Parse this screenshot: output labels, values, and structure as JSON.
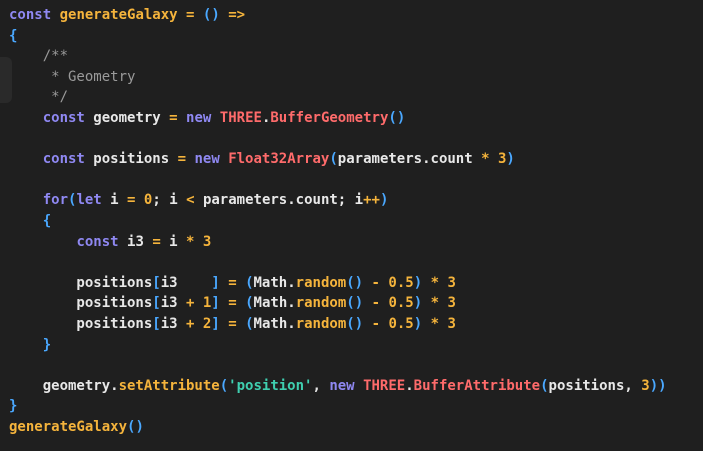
{
  "colors": {
    "background": "#1f1f1f",
    "keyword": "#8f88f2",
    "function": "#f5b43c",
    "class": "#ff6b6b",
    "bracket": "#4aa8ff",
    "string": "#3fcfb0",
    "comment": "#9a9a9a",
    "text": "#e8e8e8"
  },
  "lines": [
    [
      [
        "kw",
        "const"
      ],
      [
        "pl",
        " "
      ],
      [
        "fn",
        "generateGalaxy"
      ],
      [
        "pl",
        " "
      ],
      [
        "op",
        "="
      ],
      [
        "pl",
        " "
      ],
      [
        "br",
        "()"
      ],
      [
        "pl",
        " "
      ],
      [
        "op",
        "=>"
      ]
    ],
    [
      [
        "br",
        "{"
      ]
    ],
    [
      [
        "cm",
        "    /**"
      ]
    ],
    [
      [
        "cm",
        "     * Geometry"
      ]
    ],
    [
      [
        "cm",
        "     */"
      ]
    ],
    [
      [
        "pl",
        "    "
      ],
      [
        "kw",
        "const"
      ],
      [
        "pl",
        " geometry "
      ],
      [
        "op",
        "="
      ],
      [
        "pl",
        " "
      ],
      [
        "kw",
        "new"
      ],
      [
        "pl",
        " "
      ],
      [
        "cls",
        "THREE"
      ],
      [
        "pl",
        "."
      ],
      [
        "cls",
        "BufferGeometry"
      ],
      [
        "br",
        "()"
      ]
    ],
    [],
    [
      [
        "pl",
        "    "
      ],
      [
        "kw",
        "const"
      ],
      [
        "pl",
        " positions "
      ],
      [
        "op",
        "="
      ],
      [
        "pl",
        " "
      ],
      [
        "kw",
        "new"
      ],
      [
        "pl",
        " "
      ],
      [
        "cls",
        "Float32Array"
      ],
      [
        "br",
        "("
      ],
      [
        "pl",
        "parameters.count "
      ],
      [
        "op",
        "*"
      ],
      [
        "pl",
        " "
      ],
      [
        "num",
        "3"
      ],
      [
        "br",
        ")"
      ]
    ],
    [],
    [
      [
        "pl",
        "    "
      ],
      [
        "kw",
        "for"
      ],
      [
        "br",
        "("
      ],
      [
        "kw",
        "let"
      ],
      [
        "pl",
        " i "
      ],
      [
        "op",
        "="
      ],
      [
        "pl",
        " "
      ],
      [
        "num",
        "0"
      ],
      [
        "pl",
        "; i "
      ],
      [
        "op",
        "<"
      ],
      [
        "pl",
        " parameters.count; i"
      ],
      [
        "op",
        "++"
      ],
      [
        "br",
        ")"
      ]
    ],
    [
      [
        "pl",
        "    "
      ],
      [
        "br",
        "{"
      ]
    ],
    [
      [
        "pl",
        "        "
      ],
      [
        "kw",
        "const"
      ],
      [
        "pl",
        " i3 "
      ],
      [
        "op",
        "="
      ],
      [
        "pl",
        " i "
      ],
      [
        "op",
        "*"
      ],
      [
        "pl",
        " "
      ],
      [
        "num",
        "3"
      ]
    ],
    [],
    [
      [
        "pl",
        "        positions"
      ],
      [
        "br",
        "["
      ],
      [
        "pl",
        "i3    "
      ],
      [
        "br",
        "]"
      ],
      [
        "pl",
        " "
      ],
      [
        "op",
        "="
      ],
      [
        "pl",
        " "
      ],
      [
        "br",
        "("
      ],
      [
        "pl",
        "Math."
      ],
      [
        "fn",
        "random"
      ],
      [
        "br",
        "()"
      ],
      [
        "pl",
        " "
      ],
      [
        "op",
        "-"
      ],
      [
        "pl",
        " "
      ],
      [
        "num",
        "0.5"
      ],
      [
        "br",
        ")"
      ],
      [
        "pl",
        " "
      ],
      [
        "op",
        "*"
      ],
      [
        "pl",
        " "
      ],
      [
        "num",
        "3"
      ]
    ],
    [
      [
        "pl",
        "        positions"
      ],
      [
        "br",
        "["
      ],
      [
        "pl",
        "i3 "
      ],
      [
        "op",
        "+"
      ],
      [
        "pl",
        " "
      ],
      [
        "num",
        "1"
      ],
      [
        "br",
        "]"
      ],
      [
        "pl",
        " "
      ],
      [
        "op",
        "="
      ],
      [
        "pl",
        " "
      ],
      [
        "br",
        "("
      ],
      [
        "pl",
        "Math."
      ],
      [
        "fn",
        "random"
      ],
      [
        "br",
        "()"
      ],
      [
        "pl",
        " "
      ],
      [
        "op",
        "-"
      ],
      [
        "pl",
        " "
      ],
      [
        "num",
        "0.5"
      ],
      [
        "br",
        ")"
      ],
      [
        "pl",
        " "
      ],
      [
        "op",
        "*"
      ],
      [
        "pl",
        " "
      ],
      [
        "num",
        "3"
      ]
    ],
    [
      [
        "pl",
        "        positions"
      ],
      [
        "br",
        "["
      ],
      [
        "pl",
        "i3 "
      ],
      [
        "op",
        "+"
      ],
      [
        "pl",
        " "
      ],
      [
        "num",
        "2"
      ],
      [
        "br",
        "]"
      ],
      [
        "pl",
        " "
      ],
      [
        "op",
        "="
      ],
      [
        "pl",
        " "
      ],
      [
        "br",
        "("
      ],
      [
        "pl",
        "Math."
      ],
      [
        "fn",
        "random"
      ],
      [
        "br",
        "()"
      ],
      [
        "pl",
        " "
      ],
      [
        "op",
        "-"
      ],
      [
        "pl",
        " "
      ],
      [
        "num",
        "0.5"
      ],
      [
        "br",
        ")"
      ],
      [
        "pl",
        " "
      ],
      [
        "op",
        "*"
      ],
      [
        "pl",
        " "
      ],
      [
        "num",
        "3"
      ]
    ],
    [
      [
        "pl",
        "    "
      ],
      [
        "br",
        "}"
      ]
    ],
    [],
    [
      [
        "pl",
        "    geometry."
      ],
      [
        "fn",
        "setAttribute"
      ],
      [
        "br",
        "("
      ],
      [
        "str",
        "'position'"
      ],
      [
        "pl",
        ", "
      ],
      [
        "kw",
        "new"
      ],
      [
        "pl",
        " "
      ],
      [
        "cls",
        "THREE"
      ],
      [
        "pl",
        "."
      ],
      [
        "cls",
        "BufferAttribute"
      ],
      [
        "br",
        "("
      ],
      [
        "pl",
        "positions, "
      ],
      [
        "num",
        "3"
      ],
      [
        "br",
        "))"
      ]
    ],
    [
      [
        "br",
        "}"
      ]
    ],
    [
      [
        "fn",
        "generateGalaxy"
      ],
      [
        "br",
        "()"
      ]
    ]
  ]
}
